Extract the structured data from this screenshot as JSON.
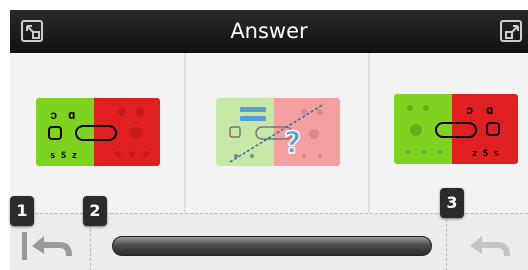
{
  "window": {
    "title": "Answer",
    "left_button_icon": "expand-icon",
    "right_button_icon": "expand-icon"
  },
  "cards": [
    {
      "name": "card-option-left",
      "icon": "comparison-diagram",
      "colors": [
        "#7ed321",
        "#e02020"
      ]
    },
    {
      "name": "card-question",
      "icon": "comparison-diagram-with-question",
      "colors": [
        "#c8e8a8",
        "#f4a0a0",
        "#5a9cd6"
      ]
    },
    {
      "name": "card-option-right",
      "icon": "comparison-diagram",
      "colors": [
        "#7ed321",
        "#e02020"
      ]
    }
  ],
  "toolbar": {
    "undo_icon": "undo-icon",
    "redo_icon": "redo-icon",
    "slider": "progress-slider"
  },
  "steps": [
    "1",
    "2",
    "3"
  ]
}
